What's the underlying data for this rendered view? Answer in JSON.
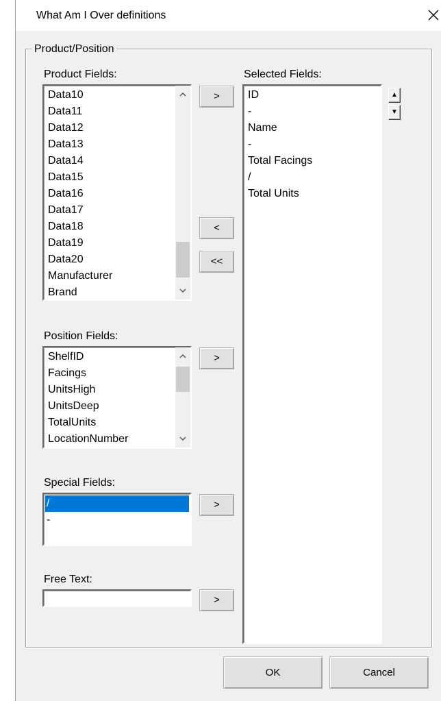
{
  "window": {
    "title": "What Am I Over definitions"
  },
  "group": {
    "label": "Product/Position"
  },
  "product_fields": {
    "label": "Product Fields:",
    "items": [
      "Data10",
      "Data11",
      "Data12",
      "Data13",
      "Data14",
      "Data15",
      "Data16",
      "Data17",
      "Data18",
      "Data19",
      "Data20",
      "Manufacturer",
      "Brand"
    ],
    "scroll_position": 0.85
  },
  "position_fields": {
    "label": "Position Fields:",
    "items": [
      "ShelfID",
      "Facings",
      "UnitsHigh",
      "UnitsDeep",
      "TotalUnits",
      "LocationNumber"
    ],
    "scroll_position": 0.2
  },
  "special_fields": {
    "label": "Special Fields:",
    "items": [
      "/",
      "-"
    ],
    "selected_index": 0
  },
  "free_text": {
    "label": "Free Text:",
    "value": ""
  },
  "selected_fields": {
    "label": "Selected Fields:",
    "items": [
      "ID",
      " -",
      "Name",
      " -",
      "Total Facings",
      " /",
      "Total Units"
    ]
  },
  "buttons": {
    "add_product": ">",
    "remove": "<",
    "remove_all": "<<",
    "add_position": ">",
    "add_special": ">",
    "add_free_text": ">",
    "ok": "OK",
    "cancel": "Cancel"
  },
  "icons": {
    "close": "close-icon",
    "scroll_up": "chevron-up-icon",
    "scroll_down": "chevron-down-icon",
    "move_up": "triangle-up-icon",
    "move_down": "triangle-down-icon"
  },
  "colors": {
    "selection": "#0078d7",
    "window_bg": "#f0f0f0"
  }
}
